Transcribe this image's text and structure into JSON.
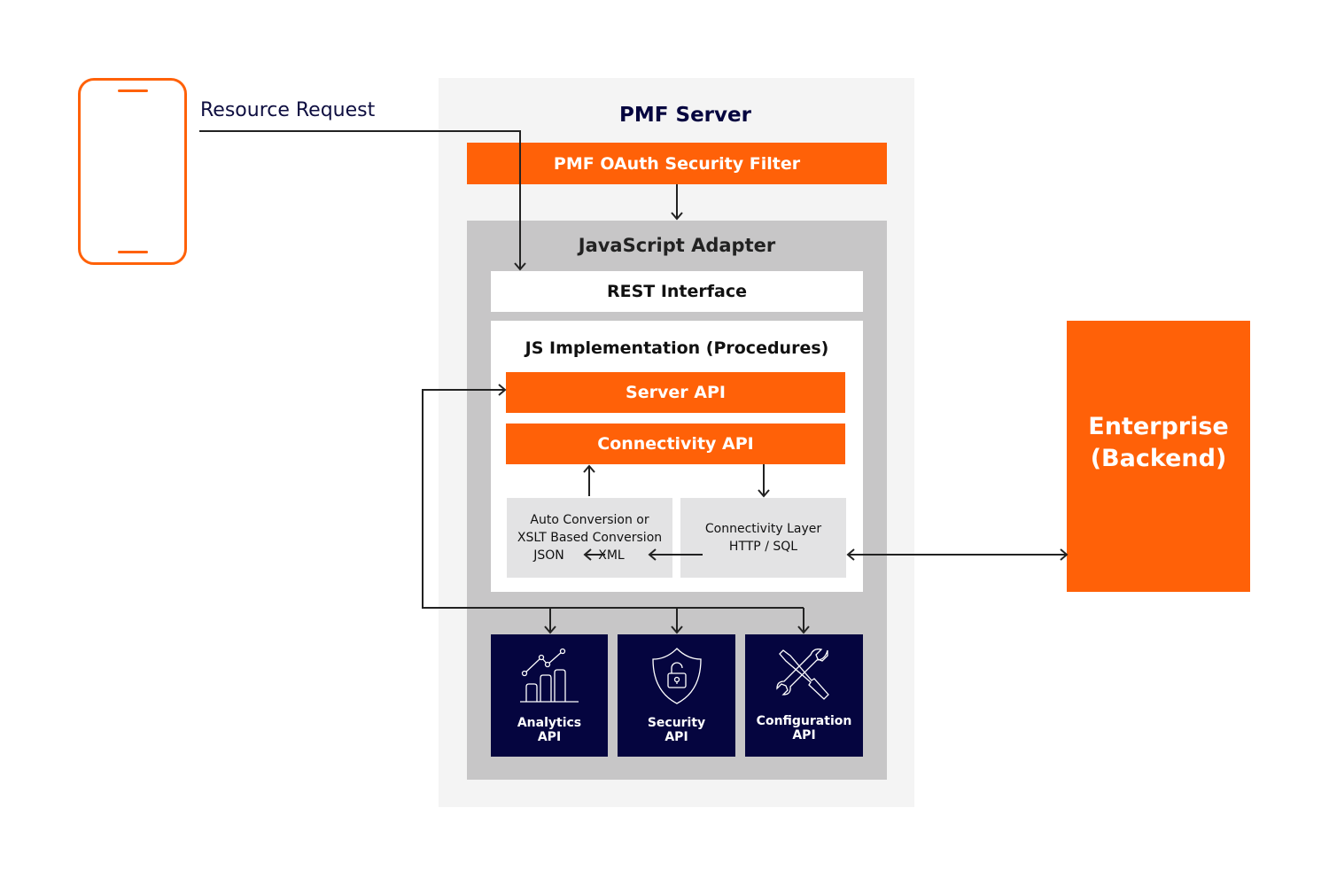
{
  "client": {
    "icon": "smartphone-icon",
    "request_label": "Resource Request"
  },
  "server": {
    "title": "PMF Server",
    "oauth_filter": "PMF OAuth Security Filter",
    "adapter": {
      "title": "JavaScript Adapter",
      "rest": "REST Interface",
      "implementation": {
        "title": "JS Implementation (Procedures)",
        "server_api": "Server API",
        "connectivity_api": "Connectivity API",
        "conversion": {
          "line1": "Auto Conversion or",
          "line2": "XSLT Based Conversion",
          "json": "JSON",
          "xml": "XML"
        },
        "connectivity_layer": {
          "line1": "Connectivity Layer",
          "line2": "HTTP / SQL"
        }
      },
      "apis": [
        {
          "icon": "analytics-chart-icon",
          "line1": "Analytics",
          "line2": "API"
        },
        {
          "icon": "shield-lock-icon",
          "line1": "Security",
          "line2": "API"
        },
        {
          "icon": "tools-icon",
          "line1": "Configuration",
          "line2": "API"
        }
      ]
    }
  },
  "enterprise": {
    "line1": "Enterprise",
    "line2": "(Backend)"
  },
  "colors": {
    "orange": "#ff6108",
    "navy": "#05053f",
    "panel": "#f4f4f4",
    "adapter": "#c7c6c7",
    "box": "#e3e3e4"
  }
}
